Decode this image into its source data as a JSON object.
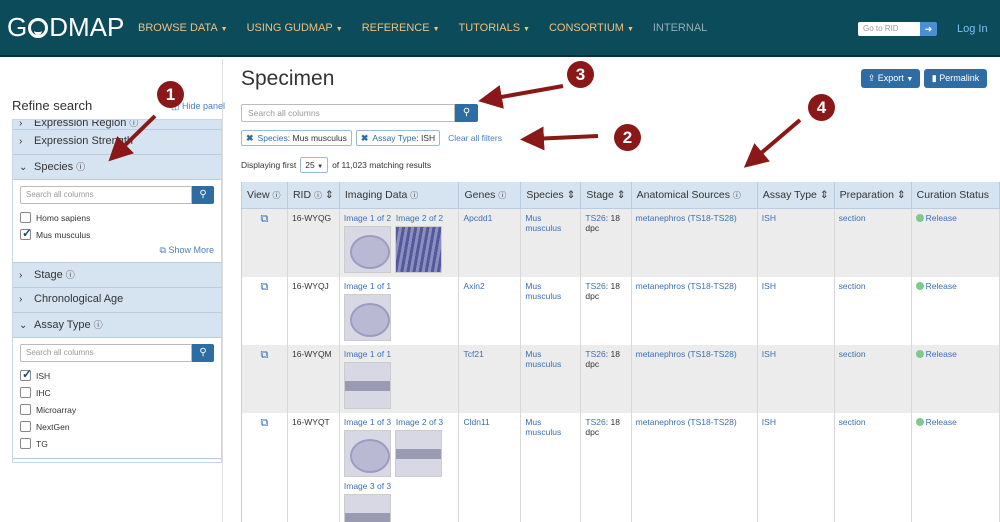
{
  "navbar": {
    "logo_left": "G",
    "logo_right": "DMAP",
    "menu": [
      {
        "label": "BROWSE DATA",
        "caret": true
      },
      {
        "label": "USING GUDMAP",
        "caret": true
      },
      {
        "label": "REFERENCE",
        "caret": true
      },
      {
        "label": "TUTORIALS",
        "caret": true
      },
      {
        "label": "CONSORTIUM",
        "caret": true
      },
      {
        "label": "INTERNAL",
        "caret": false
      }
    ],
    "rid_placeholder": "Go to RID",
    "login": "Log In"
  },
  "sidebar": {
    "title": "Refine search",
    "hide_panel": "Hide panel",
    "facets": [
      {
        "label": "Expression Region",
        "expanded": false
      },
      {
        "label": "Expression Strength",
        "expanded": false
      },
      {
        "label": "Species",
        "expanded": true,
        "search_placeholder": "Search all columns",
        "options": [
          {
            "label": "Homo sapiens",
            "checked": false
          },
          {
            "label": "Mus musculus",
            "checked": true
          }
        ],
        "show_more": "Show More"
      },
      {
        "label": "Stage",
        "expanded": false
      },
      {
        "label": "Chronological Age",
        "expanded": false
      },
      {
        "label": "Assay Type",
        "expanded": true,
        "search_placeholder": "Search all columns",
        "options": [
          {
            "label": "ISH",
            "checked": true
          },
          {
            "label": "IHC",
            "checked": false
          },
          {
            "label": "Microarray",
            "checked": false
          },
          {
            "label": "NextGen",
            "checked": false
          },
          {
            "label": "TG",
            "checked": false
          }
        ]
      }
    ]
  },
  "main": {
    "title": "Specimen",
    "export_label": "Export",
    "permalink_label": "Permalink",
    "search_placeholder": "Search all columns",
    "filters": [
      {
        "key": "Species",
        "value": "Mus musculus"
      },
      {
        "key": "Assay Type",
        "value": "ISH"
      }
    ],
    "clear_filters": "Clear all filters",
    "displaying_prefix": "Displaying first",
    "page_size": "25",
    "displaying_suffix": "of 11,023 matching results"
  },
  "table": {
    "columns": [
      "View",
      "RID",
      "Imaging Data",
      "Genes",
      "Species",
      "Stage",
      "Anatomical Sources",
      "Assay Type",
      "Preparation",
      "Curation Status"
    ],
    "rows": [
      {
        "rid": "16-WYQG",
        "images": [
          "Image 1 of 2",
          "Image 2 of 2"
        ],
        "gene": "Apcdd1",
        "species": "Mus musculus",
        "stage_link": "TS26",
        "stage_rest": ": 18 dpc",
        "anatomy": "metanephros (TS18-TS28)",
        "assay": "ISH",
        "prep": "section",
        "status": "Release"
      },
      {
        "rid": "16-WYQJ",
        "images": [
          "Image 1 of 1"
        ],
        "gene": "Axin2",
        "species": "Mus musculus",
        "stage_link": "TS26",
        "stage_rest": ": 18 dpc",
        "anatomy": "metanephros (TS18-TS28)",
        "assay": "ISH",
        "prep": "section",
        "status": "Release"
      },
      {
        "rid": "16-WYQM",
        "images": [
          "Image 1 of 1"
        ],
        "gene": "Tcf21",
        "species": "Mus musculus",
        "stage_link": "TS26",
        "stage_rest": ": 18 dpc",
        "anatomy": "metanephros (TS18-TS28)",
        "assay": "ISH",
        "prep": "section",
        "status": "Release"
      },
      {
        "rid": "16-WYQT",
        "images": [
          "Image 1 of 3",
          "Image 2 of 3",
          "Image 3 of 3"
        ],
        "gene": "Cldn11",
        "species": "Mus musculus",
        "stage_link": "TS26",
        "stage_rest": ": 18 dpc",
        "anatomy": "metanephros (TS18-TS28)",
        "assay": "ISH",
        "prep": "section",
        "status": "Release"
      }
    ]
  },
  "annotations": [
    "1",
    "2",
    "3",
    "4"
  ],
  "colors": {
    "navbar": "#0b4b5a",
    "nav_text": "#f0c080",
    "accent": "#2e6da4",
    "annotation": "#8b1818",
    "facet_header": "#d6e4f2"
  }
}
